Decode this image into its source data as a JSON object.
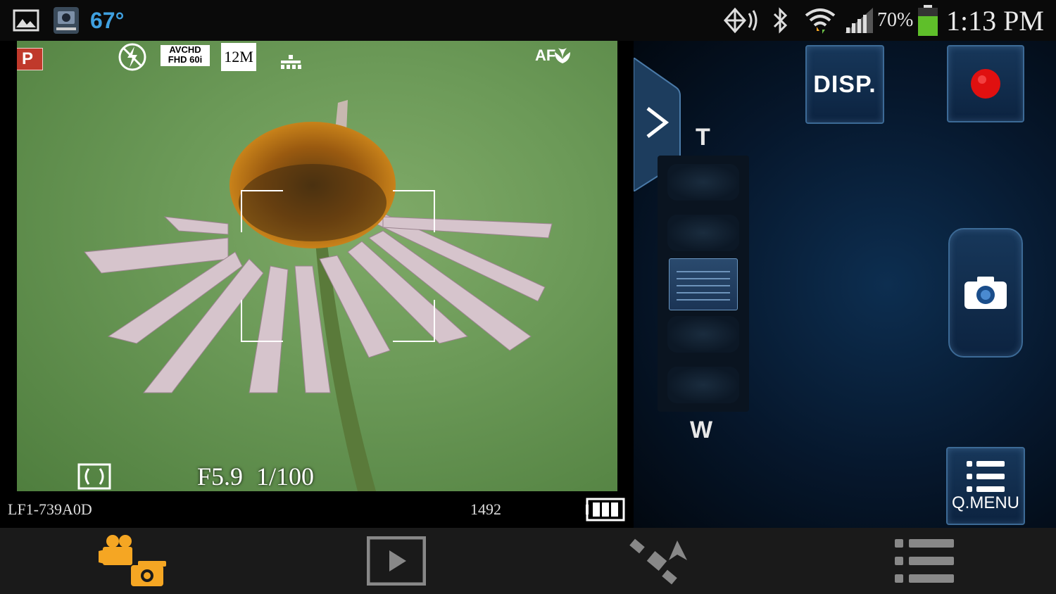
{
  "status_bar": {
    "temperature": "67°",
    "battery_percent": "70%",
    "time": "1:13 PM",
    "icons": [
      "gallery-icon",
      "panasonic-app-icon",
      "nfc-icon",
      "bluetooth-icon",
      "wifi-icon",
      "signal-icon",
      "battery-icon"
    ],
    "battery_color": "#5fbf2a",
    "temperature_color": "#3fa0e0"
  },
  "viewfinder": {
    "mode": "P",
    "flash_icon": "flash-off-icon",
    "recording_format_line1": "AVCHD",
    "recording_format_line2": "FHD 60i",
    "image_size": "12M",
    "quality_icon": "quality-icon",
    "af_mode": "AF",
    "af_macro_icon": "macro-flower-icon",
    "metering_icon": "metering-icon",
    "aperture": "F5.9",
    "shutter": "1/100"
  },
  "info_bar": {
    "device_name": "LF1-739A0D",
    "shots_remaining": "1492",
    "camera_battery_icon": "camera-battery-icon"
  },
  "panel": {
    "expand_icon": "chevron-right-icon",
    "zoom_tele": "T",
    "zoom_wide": "W",
    "disp_label": "DISP.",
    "record_icon": "record-icon",
    "shutter_icon": "camera-icon",
    "qmenu_label": "Q.MENU",
    "qmenu_icon": "list-icon",
    "accent": "#3c6a96",
    "record_color": "#e01010"
  },
  "bottom_nav": {
    "items": [
      "video-photo-mode-icon",
      "playback-icon",
      "satellite-icon",
      "menu-list-icon"
    ],
    "active_color": "#f5a623"
  }
}
